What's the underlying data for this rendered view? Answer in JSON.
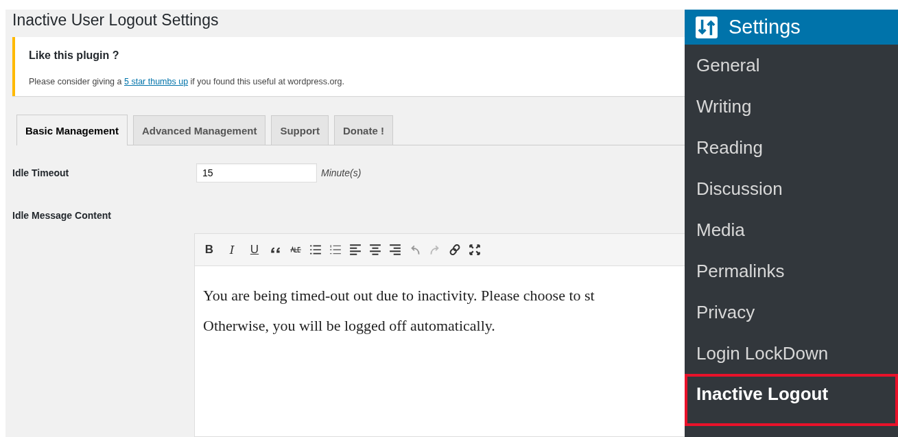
{
  "page": {
    "title": "Inactive User Logout Settings"
  },
  "notice": {
    "heading": "Like this plugin ?",
    "text_before": "Please consider giving a ",
    "link": "5 star thumbs up",
    "text_after": " if you found this useful at wordpress.org."
  },
  "tabs": [
    {
      "label": "Basic Management",
      "selected": true
    },
    {
      "label": "Advanced Management",
      "selected": false
    },
    {
      "label": "Support",
      "selected": false
    },
    {
      "label": "Donate !",
      "selected": false
    }
  ],
  "idle_timeout": {
    "label": "Idle Timeout",
    "value": "15",
    "unit": "Minute(s)"
  },
  "idle_message": {
    "label": "Idle Message Content",
    "format_buttons": [
      {
        "label": "B",
        "kind": "bold"
      },
      {
        "label": "I",
        "kind": "italic"
      },
      {
        "label": "U",
        "kind": "underline"
      }
    ],
    "paragraphs": [
      "You are being timed-out out due to inactivity. Please choose to st",
      "Otherwise, you will be logged off automatically."
    ]
  },
  "sidebar": {
    "title": "Settings",
    "items": [
      {
        "label": "General",
        "selected": false
      },
      {
        "label": "Writing",
        "selected": false
      },
      {
        "label": "Reading",
        "selected": false
      },
      {
        "label": "Discussion",
        "selected": false
      },
      {
        "label": "Media",
        "selected": false
      },
      {
        "label": "Permalinks",
        "selected": false
      },
      {
        "label": "Privacy",
        "selected": false
      },
      {
        "label": "Login LockDown",
        "selected": false
      },
      {
        "label": "Inactive Logout",
        "selected": true
      }
    ]
  }
}
